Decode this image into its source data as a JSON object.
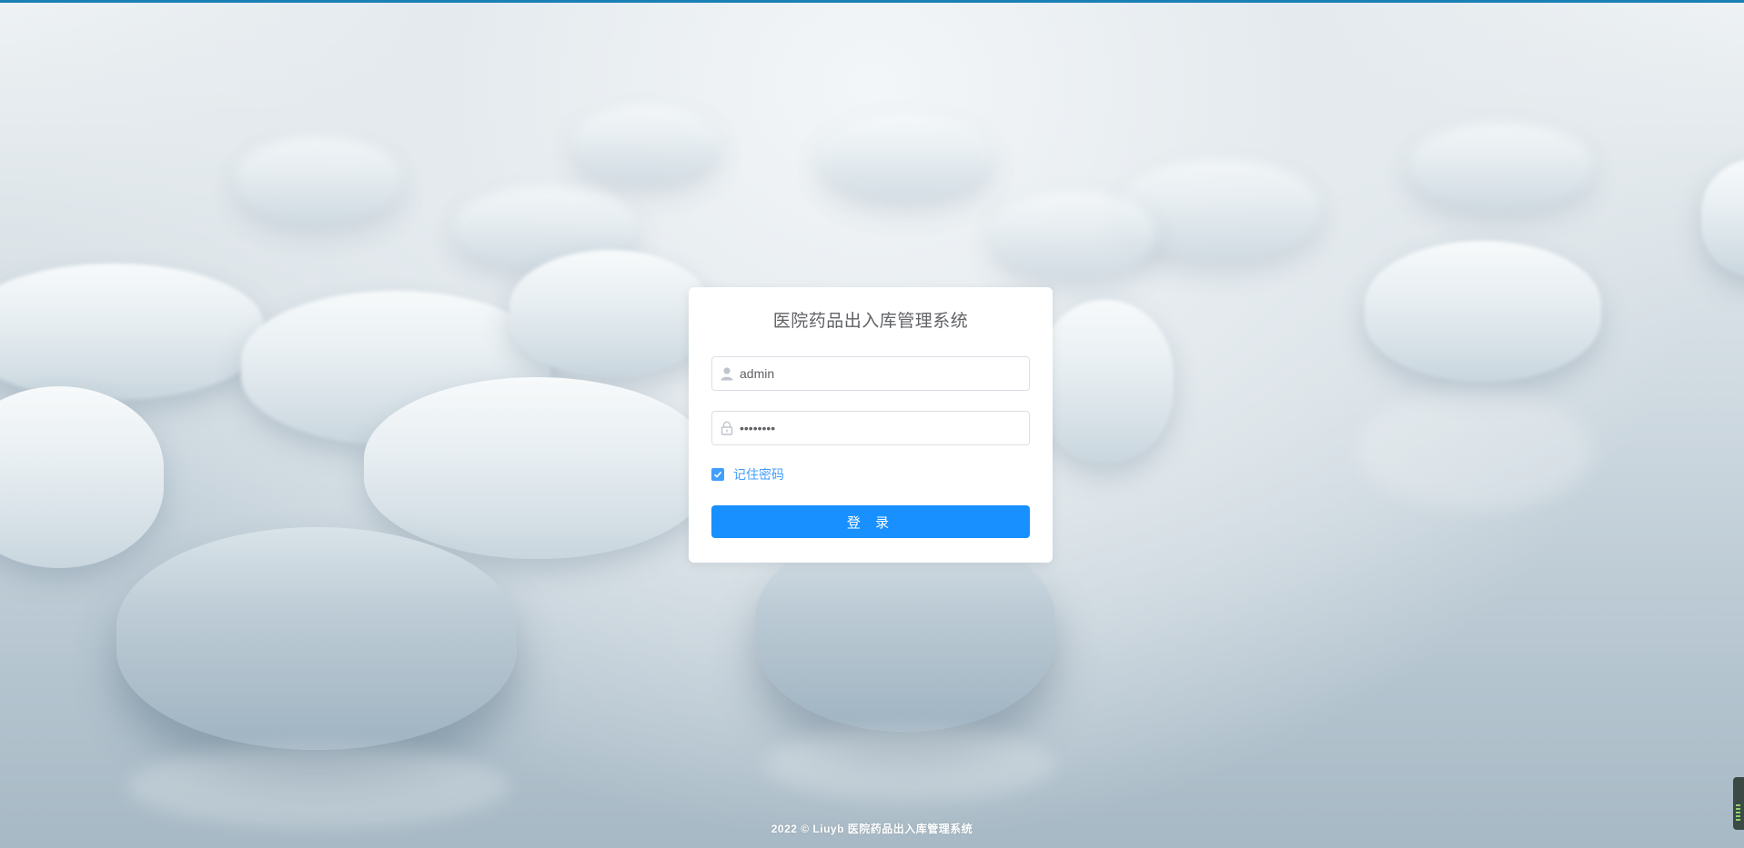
{
  "login": {
    "title": "医院药品出入库管理系统",
    "username_value": "admin",
    "password_value": "admin123",
    "remember_label": "记住密码",
    "remember_checked": true,
    "submit_label": "登 录"
  },
  "footer": {
    "text": "2022 © Liuyb 医院药品出入库管理系统"
  },
  "colors": {
    "accent": "#1890ff",
    "checkbox": "#409eff",
    "top_line": "#1a80b6"
  },
  "icons": {
    "username": "user-icon",
    "password": "lock-icon",
    "checkbox": "check-icon"
  }
}
